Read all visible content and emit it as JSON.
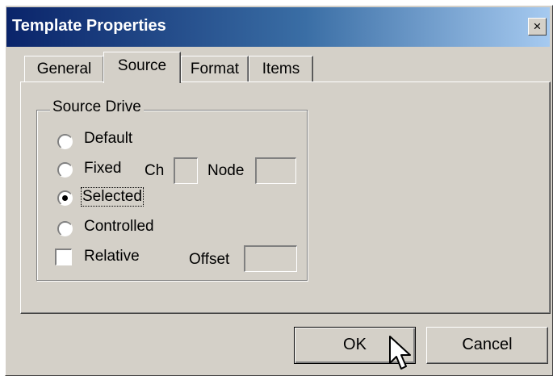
{
  "window": {
    "title": "Template Properties",
    "close_label": "×"
  },
  "tabs": [
    {
      "label": "General"
    },
    {
      "label": "Source"
    },
    {
      "label": "Format"
    },
    {
      "label": "Items"
    }
  ],
  "source_drive": {
    "group_label": "Source Drive",
    "options": [
      {
        "label": "Default",
        "checked": false
      },
      {
        "label": "Fixed",
        "checked": false
      },
      {
        "label": "Selected",
        "checked": true
      },
      {
        "label": "Controlled",
        "checked": false
      }
    ],
    "ch_label": "Ch",
    "ch_value": "",
    "node_label": "Node",
    "node_value": "",
    "relative_label": "Relative",
    "relative_checked": false,
    "offset_label": "Offset",
    "offset_value": ""
  },
  "buttons": {
    "ok_label": "OK",
    "cancel_label": "Cancel"
  }
}
